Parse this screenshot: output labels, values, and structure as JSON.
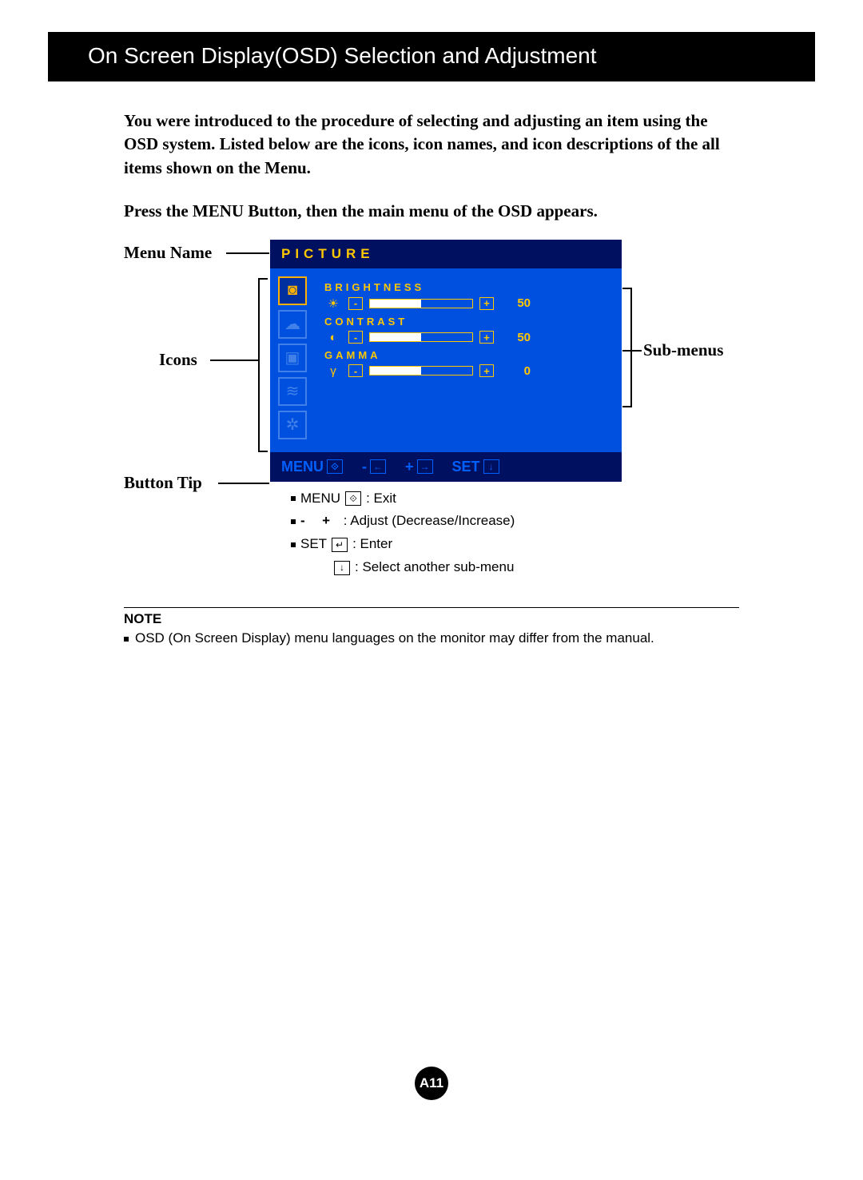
{
  "title": "On Screen Display(OSD) Selection and Adjustment",
  "intro": "You were introduced to the procedure of selecting and adjusting an item using the OSD system.  Listed below are the icons, icon names, and icon descriptions of the all items shown on the Menu.",
  "instruction": "Press the MENU Button, then the main menu of the OSD appears.",
  "labels": {
    "menu_name": "Menu Name",
    "icons": "Icons",
    "button_tip": "Button Tip",
    "sub_menus": "Sub-menus"
  },
  "osd": {
    "menu_title": "PICTURE",
    "icons": [
      {
        "name": "picture-icon",
        "glyph": "◙",
        "selected": true
      },
      {
        "name": "color-icon",
        "glyph": "☁",
        "selected": false
      },
      {
        "name": "screen-icon",
        "glyph": "▣",
        "selected": false
      },
      {
        "name": "tracking-icon",
        "glyph": "≋",
        "selected": false
      },
      {
        "name": "setup-icon",
        "glyph": "✲",
        "selected": false
      }
    ],
    "submenus": [
      {
        "label": "BRIGHTNESS",
        "icon": "☀",
        "value": "50",
        "fill_pct": 50
      },
      {
        "label": "CONTRAST",
        "icon": "◐",
        "value": "50",
        "fill_pct": 50
      },
      {
        "label": "GAMMA",
        "icon": "γ",
        "value": "0",
        "fill_pct": 50
      }
    ],
    "footer": {
      "menu": "MENU",
      "minus": "-",
      "plus": "+",
      "set": "SET"
    }
  },
  "tips": {
    "menu_label": "MENU",
    "menu_desc": ": Exit",
    "adjust_minus": "-",
    "adjust_plus": "+",
    "adjust_desc": ": Adjust (Decrease/Increase)",
    "set_label": "SET",
    "set_desc": ": Enter",
    "select_desc": ": Select another sub-menu"
  },
  "note": {
    "label": "NOTE",
    "text": "OSD (On Screen Display) menu languages on the monitor may differ from the manual."
  },
  "page_number": "A11"
}
